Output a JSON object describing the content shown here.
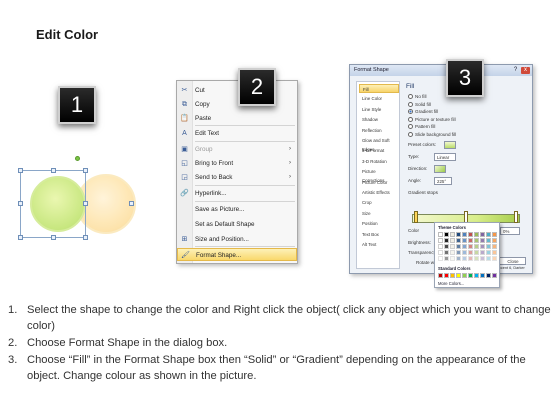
{
  "title": "Edit Color",
  "badges": [
    "1",
    "2",
    "3"
  ],
  "context_menu": {
    "items": [
      {
        "label": "Cut",
        "icon": "scissors-icon",
        "glyph": "✂"
      },
      {
        "label": "Copy",
        "icon": "copy-icon",
        "glyph": "⧉"
      },
      {
        "label": "Paste",
        "icon": "paste-icon",
        "glyph": "📋"
      },
      {
        "label": "Edit Text",
        "icon": "text-icon",
        "glyph": "A"
      },
      {
        "label": "Group",
        "icon": "group-icon",
        "glyph": "▣",
        "disabled": true,
        "submenu": true
      },
      {
        "label": "Bring to Front",
        "icon": "bring-front-icon",
        "glyph": "◱",
        "submenu": true
      },
      {
        "label": "Send to Back",
        "icon": "send-back-icon",
        "glyph": "◲",
        "submenu": true
      },
      {
        "label": "Hyperlink...",
        "icon": "hyperlink-icon",
        "glyph": "🔗"
      },
      {
        "label": "Save as Picture...",
        "icon": "none",
        "glyph": ""
      },
      {
        "label": "Set as Default Shape",
        "icon": "none",
        "glyph": ""
      },
      {
        "label": "Size and Position...",
        "icon": "size-icon",
        "glyph": "⊞"
      },
      {
        "label": "Format Shape...",
        "icon": "format-shape-icon",
        "glyph": "🖌",
        "highlight": true
      }
    ]
  },
  "dialog": {
    "title": "Format Shape",
    "help": "?",
    "close": "x",
    "nav": [
      "Fill",
      "Line Color",
      "Line Style",
      "Shadow",
      "Reflection",
      "Glow and Soft Edges",
      "3-D Format",
      "3-D Rotation",
      "Picture Corrections",
      "Picture Color",
      "Artistic Effects",
      "Crop",
      "Size",
      "Position",
      "Text Box",
      "Alt Text"
    ],
    "fill_heading": "Fill",
    "fill_options": [
      {
        "label": "No fill",
        "selected": false
      },
      {
        "label": "Solid fill",
        "selected": false
      },
      {
        "label": "Gradient fill",
        "selected": true
      },
      {
        "label": "Picture or texture fill",
        "selected": false
      },
      {
        "label": "Pattern fill",
        "selected": false
      },
      {
        "label": "Slide background fill",
        "selected": false
      }
    ],
    "fields": {
      "preset_label": "Preset colors:",
      "type_label": "Type:",
      "type_value": "Linear",
      "direction_label": "Direction:",
      "angle_label": "Angle:",
      "angle_value": "225°",
      "stops_label": "Gradient stops",
      "color_label": "Color",
      "position_label": "Position:",
      "position_value": "0%",
      "brightness_label": "Brightness:",
      "transparency_label": "Transparency:",
      "rotate_label": "Rotate with shape",
      "close_button": "Close",
      "status_text": "Green, Accent 6, Darker"
    }
  },
  "color_popup": {
    "theme_label": "Theme Colors",
    "standard_label": "Standard Colors",
    "more_label": "More Colors...",
    "standard_colors": [
      "#c00000",
      "#ff0000",
      "#ffc000",
      "#ffff00",
      "#92d050",
      "#00b050",
      "#00b0f0",
      "#0070c0",
      "#002060",
      "#7030a0"
    ],
    "theme_colors": [
      "#ffffff",
      "#000000",
      "#eeece1",
      "#1f497d",
      "#4f81bd",
      "#c0504d",
      "#9bbb59",
      "#8064a2",
      "#4bacc6",
      "#f79646"
    ]
  },
  "steps": [
    {
      "num": "1.",
      "text": "Select the shape to change the color and Right click the object( click any object which you want to change color)"
    },
    {
      "num": "2.",
      "text": "Choose Format Shape in the dialog box."
    },
    {
      "num": "3.",
      "text": "Choose “Fill” in the Format Shape box then “Solid” or “Gradient” depending on the appearance of the object. Change colour as shown in the picture."
    }
  ]
}
